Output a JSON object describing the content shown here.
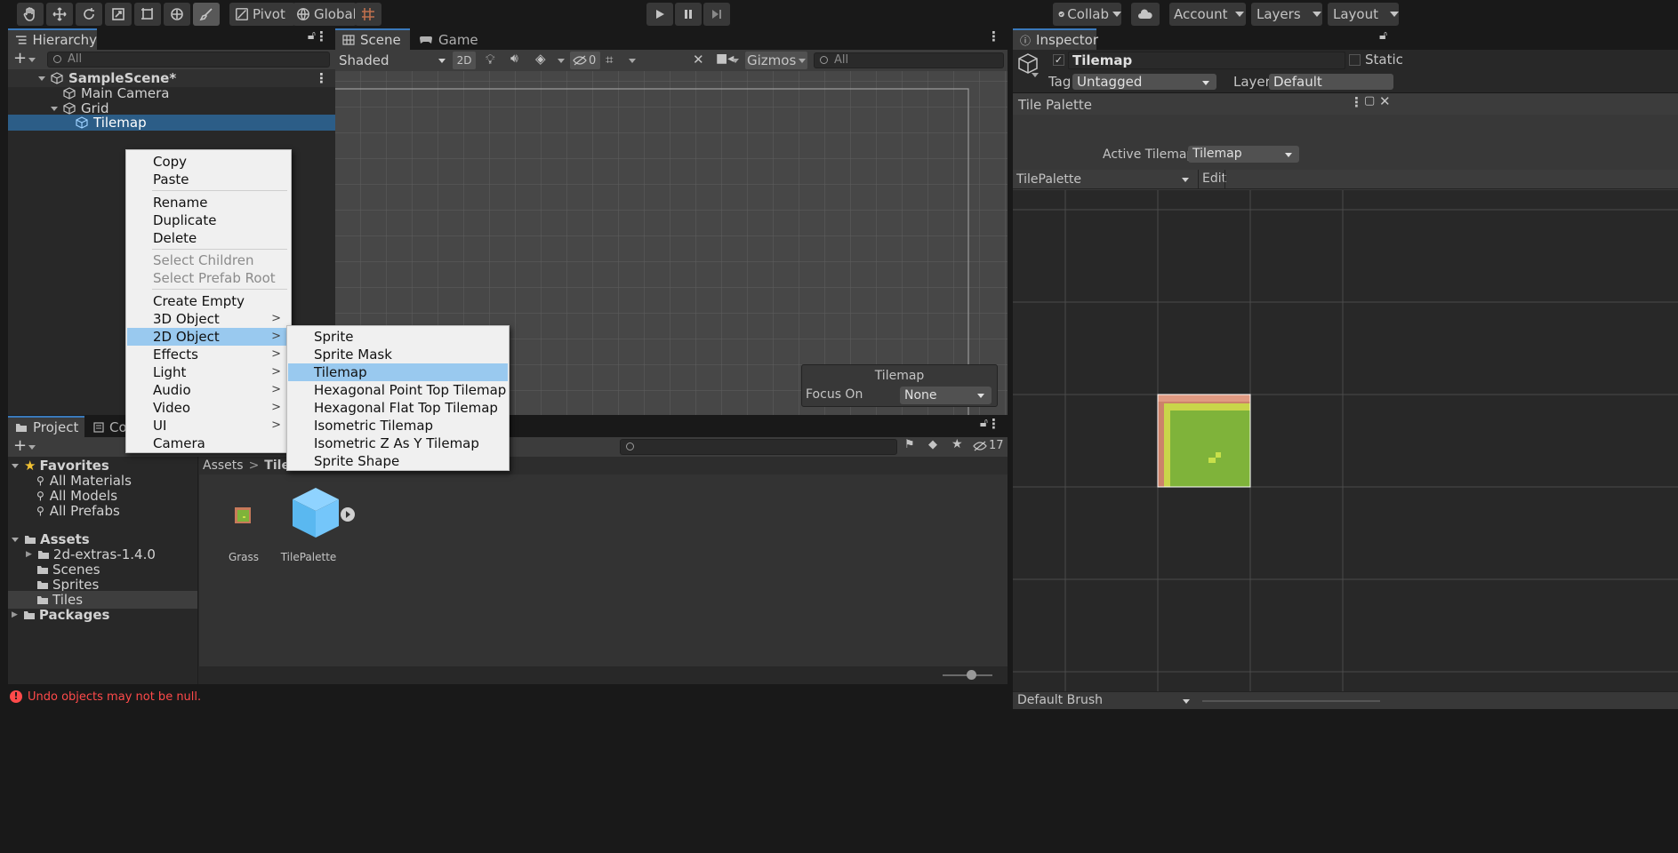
{
  "toolbar": {
    "pivot": "Pivot",
    "global": "Global",
    "collab": "Collab",
    "account": "Account",
    "layers": "Layers",
    "layout": "Layout"
  },
  "hierarchy": {
    "tab": "Hierarchy",
    "search_placeholder": "All",
    "items": [
      "SampleScene*",
      "Main Camera",
      "Grid",
      "Tilemap"
    ]
  },
  "scene": {
    "tabs": [
      "Scene",
      "Game"
    ],
    "shading": "Shaded",
    "mode2d": "2D",
    "hidden_count": "0",
    "gizmos": "Gizmos",
    "search_placeholder": "All",
    "overlay": {
      "title": "Tilemap",
      "focus_label": "Focus On",
      "focus_value": "None"
    }
  },
  "context_menu": {
    "items": [
      "Copy",
      "Paste",
      "Rename",
      "Duplicate",
      "Delete",
      "Select Children",
      "Select Prefab Root",
      "Create Empty",
      "3D Object",
      "2D Object",
      "Effects",
      "Light",
      "Audio",
      "Video",
      "UI",
      "Camera"
    ],
    "submenu_arrow": ">",
    "submenu": [
      "Sprite",
      "Sprite Mask",
      "Tilemap",
      "Hexagonal Point Top Tilemap",
      "Hexagonal Flat Top Tilemap",
      "Isometric Tilemap",
      "Isometric Z As Y Tilemap",
      "Sprite Shape"
    ]
  },
  "project": {
    "tabs": [
      "Project",
      "Con"
    ],
    "hidden_count": "17",
    "breadcrumb": [
      "Assets",
      "Tiles"
    ],
    "breadcrumb_sep": ">",
    "favorites_label": "Favorites",
    "favorites": [
      "All Materials",
      "All Models",
      "All Prefabs"
    ],
    "assets_label": "Assets",
    "assets": [
      "2d-extras-1.4.0",
      "Scenes",
      "Sprites",
      "Tiles"
    ],
    "packages_label": "Packages",
    "files": [
      "Grass",
      "TilePalette"
    ]
  },
  "status": {
    "error": "Undo objects may not be null."
  },
  "inspector": {
    "tab": "Inspector",
    "object_name": "Tilemap",
    "static_label": "Static",
    "tag_label": "Tag",
    "tag_value": "Untagged",
    "layer_label": "Layer",
    "layer_value": "Default"
  },
  "tile_palette": {
    "tab": "Tile Palette",
    "active_label": "Active Tilemap",
    "active_value": "Tilemap",
    "palette": "TilePalette",
    "edit": "Edit",
    "brush": "Default Brush"
  },
  "colors": {
    "accent": "#3a79bb",
    "selection": "#2c5d87",
    "menu_highlight": "#99c9ef",
    "error": "#ff4a4a"
  }
}
